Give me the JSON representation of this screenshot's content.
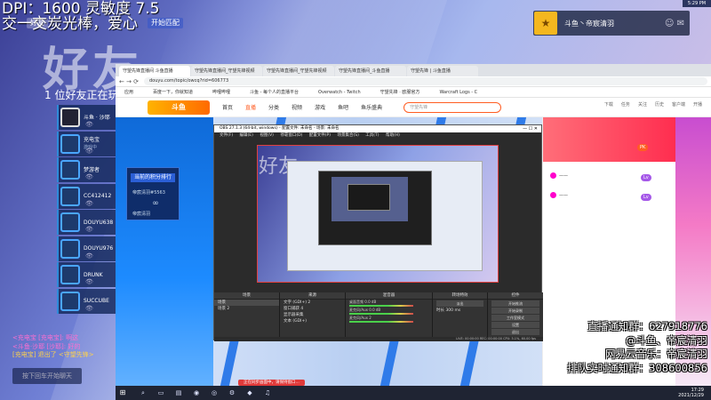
{
  "overlay_left": {
    "dpi_line": "DPI：1600 灵敏度 7.5",
    "slogan": "交一交炭光棒，爱心",
    "chip_game": "好友",
    "chip_match": "开始匹配",
    "friends_online": "1 位好友正在玩"
  },
  "friends": [
    {
      "name": "斗鱼 · 沙耶",
      "status": ""
    },
    {
      "name": "充电宝",
      "status": "游戏中"
    },
    {
      "name": "梦游者",
      "status": ""
    },
    {
      "name": "CC412412",
      "status": ""
    },
    {
      "name": "DOUYU638",
      "status": ""
    },
    {
      "name": "DOUYU976",
      "status": ""
    },
    {
      "name": "DRUNK",
      "status": ""
    },
    {
      "name": "SUCCUBE",
      "status": ""
    }
  ],
  "chat": [
    {
      "text": "<充电宝 [充电宝]: 啊这",
      "color": "#ff6fd0"
    },
    {
      "text": "<斗鱼·沙耶 [沙耶]: 好的",
      "color": "#ff6fd0"
    },
    {
      "text": "[充电宝] 退出了 <守望先锋>",
      "color": "#ffd24a"
    }
  ],
  "chat_button": "按下回车开始聊天",
  "hud": {
    "user": "斗鱼丶帝宸清羽",
    "top_right": "5:29 PM"
  },
  "browser": {
    "tabs": [
      {
        "label": "守望先锋直播间 斗鱼直播",
        "active": true
      },
      {
        "label": "守望先锋直播间_守望先锋视频",
        "active": false
      },
      {
        "label": "守望先锋直播间_守望先锋视频",
        "active": false
      },
      {
        "label": "守望先锋直播间_斗鱼直播",
        "active": false
      },
      {
        "label": "守望先锋 | 斗鱼直播",
        "active": false
      }
    ],
    "url": "douyu.com/topic/owcq?rid=606773",
    "bookmarks": [
      "应用",
      "百度一下，你就知道",
      "哔哩哔哩",
      "斗鱼 - 每个人的直播平台",
      "Overwatch - Twitch",
      "守望先锋 · 欧服官方",
      "Warcraft Logs - C"
    ],
    "site_nav": [
      "首页",
      "直播",
      "分类",
      "视频",
      "游戏",
      "鱼吧",
      "鱼乐盛典"
    ],
    "search_placeholder": "守望先锋",
    "nav_icons": [
      "下载",
      "任务",
      "关注",
      "历史",
      "客户端",
      "开播"
    ],
    "obs_window_label": "正在同步画面中，请保持窗口...",
    "pk_title": "当前的积分排行",
    "pk_rows": [
      "帝宸清羽#5563",
      "帝宸清羽"
    ]
  },
  "obs": {
    "title": "OBS 27.1.3 (64-bit, windows) - 配置文件: 未命名 - 场景: 未命名",
    "menus": [
      "文件(F)",
      "编辑(E)",
      "视图(V)",
      "停靠窗口(D)",
      "配置文件(P)",
      "场景集合(S)",
      "工具(T)",
      "帮助(H)"
    ],
    "docks": {
      "scenes": {
        "header": "场景",
        "items": [
          "场景",
          "场景 2"
        ]
      },
      "sources": {
        "header": "来源",
        "items": [
          "文字 (GDI+) 2",
          "窗口捕获 4",
          "显示器采集",
          "文本 (GDI+)"
        ]
      },
      "mixer": {
        "header": "混音器",
        "rows": [
          "桌面音频  0.0 dB",
          "麦克风/Aux  0.0 dB",
          "麦克风/Aux 2"
        ]
      },
      "transitions": {
        "header": "转场特效",
        "type": "淡出",
        "duration_label": "时长",
        "duration": "300 ms"
      },
      "controls": {
        "header": "控件",
        "buttons": [
          "开始推流",
          "开始录制",
          "工作室模式",
          "设置",
          "退出"
        ]
      }
    },
    "status": "LIVE: 00:00:00  REC: 00:00:00  CPU: 5.1%, 60.00 fps"
  },
  "taskbar": {
    "notice": "正在同步画面中，请保持窗口...",
    "time": "17:29",
    "date": "2021/12/29"
  },
  "overlay_right": [
    "直播通知群：627918776",
    "@斗鱼、帝宸清羽",
    "网易云音乐：帝宸清羽",
    "排队实时通知群：308600856"
  ]
}
